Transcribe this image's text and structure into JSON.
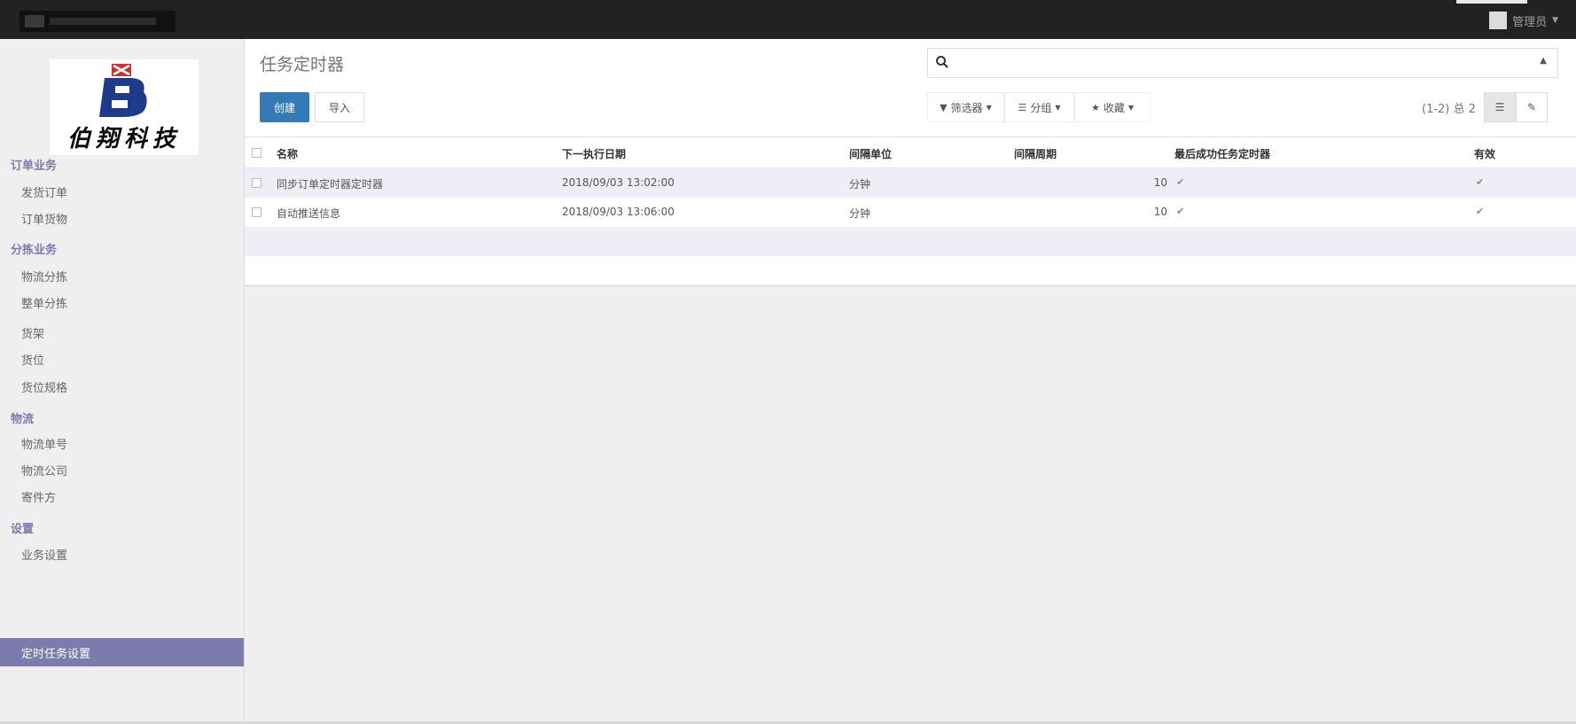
{
  "topbar": {
    "user_name": "管理员"
  },
  "sidebar": {
    "logo_text": "伯翔科技",
    "groups": [
      {
        "label": "订单业务",
        "items": [
          "发货订单",
          "订单货物"
        ]
      },
      {
        "label": "分拣业务",
        "items": [
          "物流分拣",
          "整单分拣",
          "货架",
          "货位",
          "货位规格"
        ]
      },
      {
        "label": "物流",
        "items": [
          "物流单号",
          "物流公司",
          "寄件方"
        ]
      },
      {
        "label": "设置",
        "items": [
          "业务设置"
        ]
      }
    ],
    "active_item": "定时任务设置"
  },
  "control_panel": {
    "title": "任务定时器",
    "create_label": "创建",
    "import_label": "导入",
    "search": {
      "placeholder": "",
      "value": ""
    },
    "filters_label": "筛选器",
    "group_by_label": "分组",
    "favorites_label": "收藏",
    "pager": "(1-2) 总 2"
  },
  "table": {
    "columns": [
      "名称",
      "下一执行日期",
      "间隔单位",
      "间隔周期",
      "最后成功任务定时器",
      "有效"
    ],
    "rows": [
      {
        "name": "同步订单定时器定时器",
        "next_date": "2018/09/03 13:02:00",
        "unit": "分钟",
        "period": "10",
        "last_success": true,
        "active": true
      },
      {
        "name": "自动推送信息",
        "next_date": "2018/09/03 13:06:00",
        "unit": "分钟",
        "period": "10",
        "last_success": true,
        "active": true
      }
    ]
  },
  "colors": {
    "topbar": "#222222",
    "sidebar_accent": "#7c7bad",
    "primary_button": "#337ab7",
    "logo_blue": "#1e3a8a",
    "logo_red": "#d32f2f"
  }
}
